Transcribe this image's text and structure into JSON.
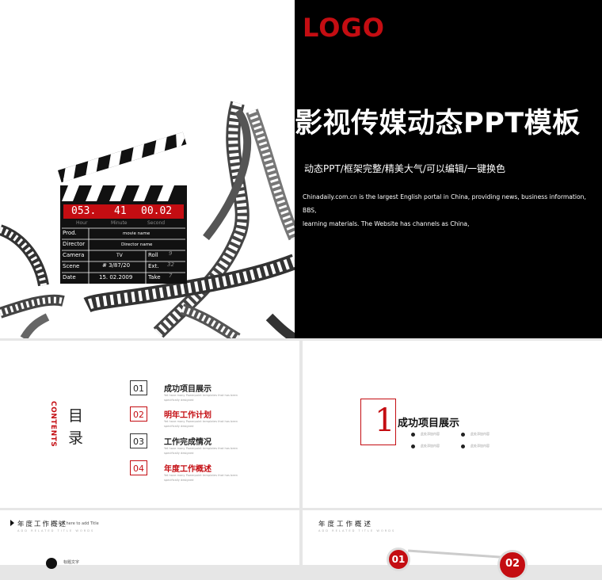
{
  "hero": {
    "logo": "LOGO",
    "title": "影视传媒动态PPT模板",
    "subtitle": "动态PPT/框架完整/精美大气/可以编辑/一键换色",
    "description_line1": "Chinadaily.com.cn is the largest English portal in China, providing news, business information, BBS,",
    "description_line2": "learning materials. The Website has channels as China,",
    "clapper": {
      "counter": [
        "053.",
        "41",
        "00.02"
      ],
      "counter_labels": [
        "Hour",
        "Minute",
        "Second"
      ],
      "rows": [
        {
          "label": "Prod.",
          "value": "movie name"
        },
        {
          "label": "Director",
          "value": "Director name"
        },
        {
          "label": "Camera",
          "value": "TV",
          "label2": "Roll",
          "value2": "9"
        },
        {
          "label": "Scene",
          "value": "# 3/87/20",
          "label2": "Ext.",
          "value2": "32"
        },
        {
          "label": "Date",
          "value": "15. 02.2009",
          "label2": "Take",
          "value2": "7"
        }
      ]
    }
  },
  "toc": {
    "title_char1": "目",
    "title_char2": "录",
    "title_en": "CONTENTS",
    "items": [
      {
        "num": "01",
        "title": "成功项目展示",
        "desc": "Yet have many Powerpoint templates that has been specifically designed"
      },
      {
        "num": "02",
        "title": "明年工作计划",
        "desc": "Yet have many Powerpoint templates that has been specifically designed"
      },
      {
        "num": "03",
        "title": "工作完成情况",
        "desc": "Yet have many Powerpoint templates that has been specifically designed"
      },
      {
        "num": "04",
        "title": "年度工作概述",
        "desc": "Yet have many Powerpoint templates that has been specifically designed"
      }
    ]
  },
  "section1": {
    "num": "1",
    "title": "成功项目展示",
    "bullets": [
      "此处添加内容",
      "此处添加内容",
      "此处添加内容",
      "此处添加内容"
    ]
  },
  "bottom_left": {
    "title": "年度工作概述",
    "overlay": "Click here to add Title",
    "subtitle": "ADD RELATED TITLE WORDS",
    "label": "标题文字"
  },
  "bottom_right": {
    "title": "年度工作概述",
    "subtitle": "ADD RELATED TITLE WORDS",
    "badges": [
      "01",
      "02"
    ]
  },
  "colors": {
    "accent": "#c40d12",
    "dark": "#000000"
  }
}
